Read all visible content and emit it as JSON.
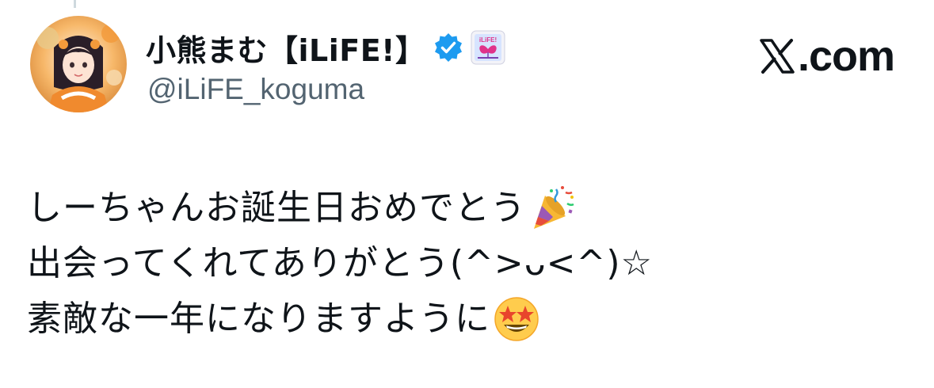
{
  "author": {
    "display_name": "小熊まむ【iLiFE!】",
    "handle": "@iLiFE_koguma",
    "verified": true,
    "affiliate_badge_text": "iLiFE!"
  },
  "brand": {
    "icon": "x-logo-icon",
    "text": ".com"
  },
  "tweet": {
    "lines": [
      "しーちゃんお誕生日おめでとう",
      "出会ってくれてありがとう(^>ᴗ<^)☆",
      "素敵な一年になりますように"
    ],
    "emojis": [
      "party-popper-icon",
      "star-struck-icon"
    ]
  },
  "colors": {
    "text": "#0f1419",
    "secondary": "#536471",
    "verified_blue": "#1d9bf0",
    "badge_pink": "#e0338a"
  }
}
